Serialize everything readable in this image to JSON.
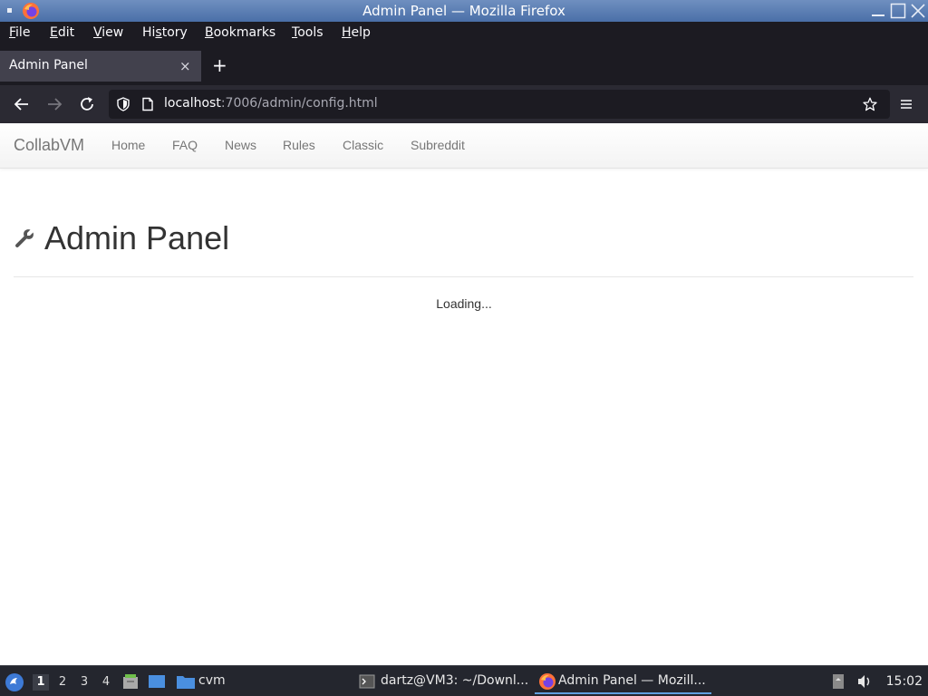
{
  "window": {
    "title": "Admin Panel — Mozilla Firefox"
  },
  "menubar": {
    "items": [
      {
        "label": "File",
        "underline": "F",
        "rest": "ile"
      },
      {
        "label": "Edit",
        "underline": "E",
        "rest": "dit"
      },
      {
        "label": "View",
        "underline": "V",
        "rest": "iew"
      },
      {
        "label": "History",
        "pre": "Hi",
        "underline": "s",
        "rest": "tory"
      },
      {
        "label": "Bookmarks",
        "underline": "B",
        "rest": "ookmarks"
      },
      {
        "label": "Tools",
        "underline": "T",
        "rest": "ools"
      },
      {
        "label": "Help",
        "underline": "H",
        "rest": "elp"
      }
    ]
  },
  "tabs": [
    {
      "label": "Admin Panel",
      "close": "×"
    }
  ],
  "newtab_label": "+",
  "urlbar": {
    "host": "localhost",
    "path": ":7006/admin/config.html"
  },
  "site_nav": {
    "brand": "CollabVM",
    "links": [
      "Home",
      "FAQ",
      "News",
      "Rules",
      "Classic",
      "Subreddit"
    ]
  },
  "page": {
    "title": "Admin Panel",
    "title_icon": "wrench-icon",
    "status": "Loading..."
  },
  "taskbar": {
    "workspaces": [
      "1",
      "2",
      "3",
      "4"
    ],
    "active_workspace": "1",
    "folder_label": "cvm",
    "tasks": [
      {
        "label": "dartz@VM3: ~/Downl...",
        "icon": "terminal-icon"
      },
      {
        "label": "Admin Panel — Mozill...",
        "icon": "firefox-icon",
        "active": true
      }
    ],
    "clock": "15:02"
  },
  "colors": {
    "titlebar": "#4a6fa8",
    "browser_chrome": "#1c1b22",
    "toolbar": "#2b2a33",
    "taskbar": "#24262e",
    "accent": "#5fa0e0"
  }
}
